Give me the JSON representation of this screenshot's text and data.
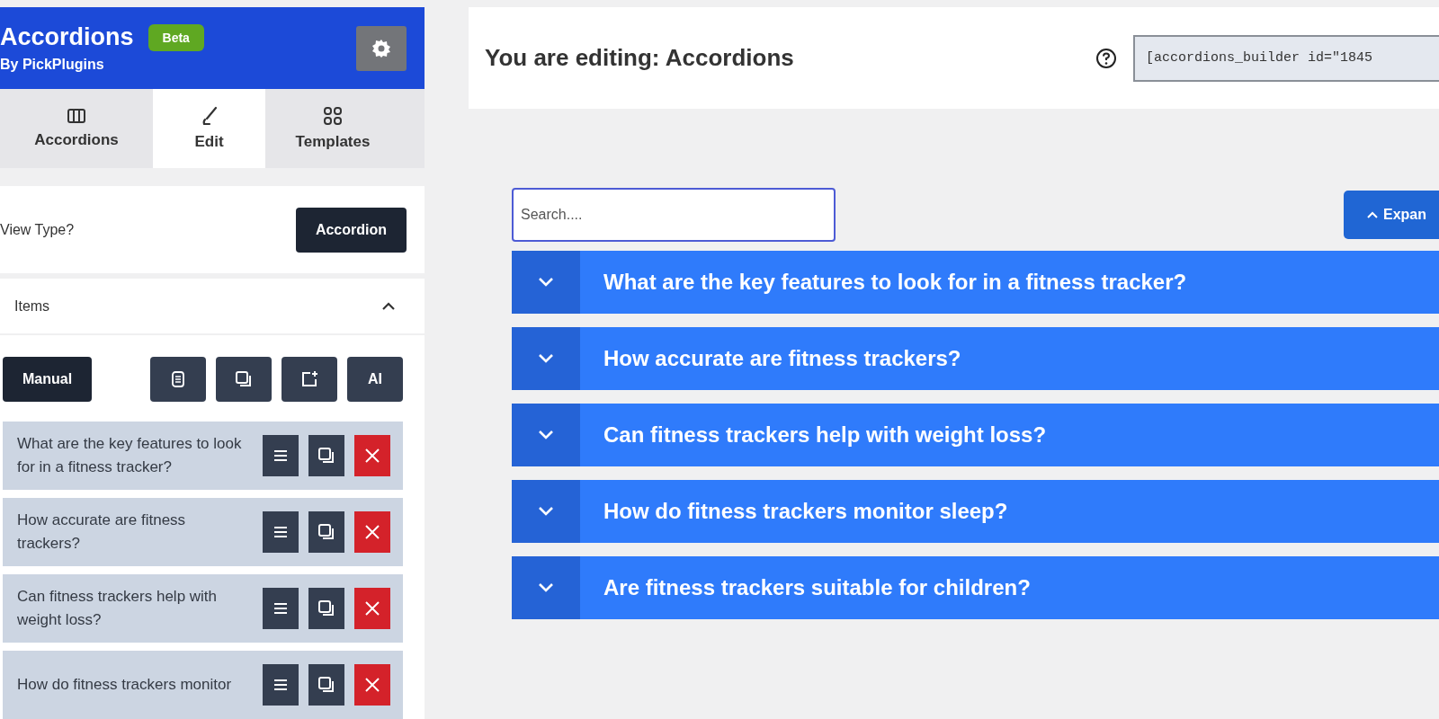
{
  "sidebar": {
    "title": "Accordions",
    "badge": "Beta",
    "subtitle": "By PickPlugins",
    "tabs": [
      {
        "label": "Accordions",
        "selected": false
      },
      {
        "label": "Edit",
        "selected": true
      },
      {
        "label": "Templates",
        "selected": false
      }
    ],
    "view_type": {
      "label": "View Type?",
      "value": "Accordion"
    },
    "items_section": {
      "title": "Items",
      "expanded": true,
      "source_button": "Manual",
      "tools": [
        {
          "kind": "document"
        },
        {
          "kind": "copy"
        },
        {
          "kind": "add"
        },
        {
          "kind": "text",
          "label": "AI"
        }
      ],
      "items": [
        {
          "text": "What are the key features to look for in a fitness tracker?"
        },
        {
          "text": "How accurate are fitness trackers?"
        },
        {
          "text": "Can fitness trackers help with weight loss?"
        },
        {
          "text": "How do fitness trackers monitor"
        }
      ]
    }
  },
  "main": {
    "heading": "You are editing: Accordions",
    "shortcode": "[accordions_builder id=\"1845",
    "search": {
      "placeholder": "Search...."
    },
    "expand_button": "Expan",
    "accordions": [
      {
        "title": "What are the key features to look for in a fitness tracker?",
        "expanded": false
      },
      {
        "title": "How accurate are fitness trackers?",
        "expanded": false
      },
      {
        "title": "Can fitness trackers help with weight loss?",
        "expanded": false
      },
      {
        "title": "How do fitness trackers monitor sleep?",
        "expanded": false
      },
      {
        "title": "Are fitness trackers suitable for children?",
        "expanded": false
      }
    ]
  }
}
